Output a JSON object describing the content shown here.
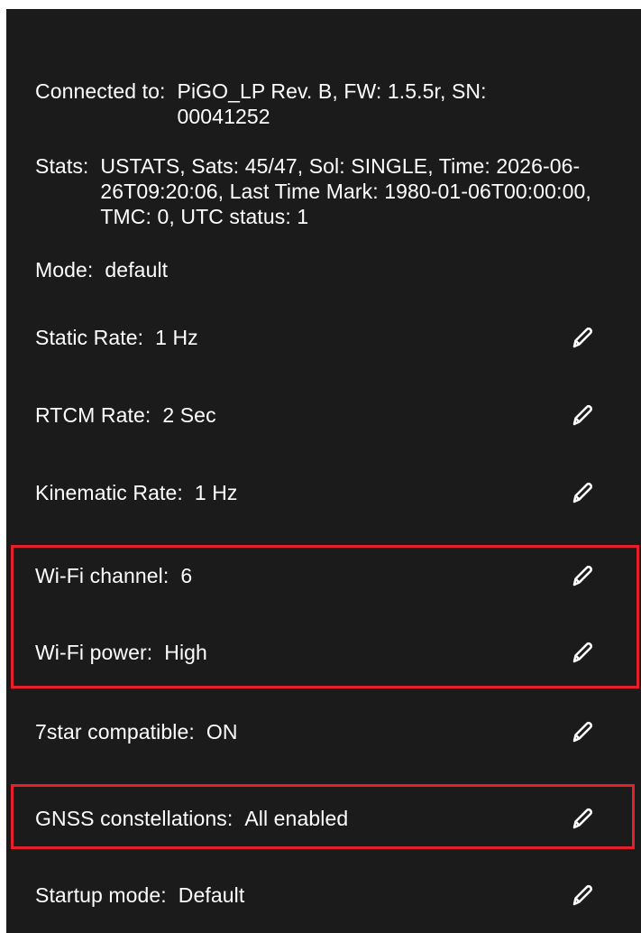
{
  "info": {
    "connected": {
      "label": "Connected to:  ",
      "value": "PiGO_LP Rev. B, FW: 1.5.5r, SN: 00041252"
    },
    "stats": {
      "label": "Stats:  ",
      "value": "USTATS, Sats: 45/47, Sol: SINGLE, Time: 2026-06-26T09:20:06, Last Time Mark: 1980-01-06T00:00:00, TMC: 0, UTC status: 1"
    },
    "mode": {
      "label": "Mode:  ",
      "value": "default"
    }
  },
  "settings": [
    {
      "label": "Static Rate:  ",
      "value": "1 Hz"
    },
    {
      "label": "RTCM Rate:  ",
      "value": "2 Sec"
    },
    {
      "label": "Kinematic Rate:  ",
      "value": "1 Hz"
    },
    {
      "label": "Wi-Fi channel:  ",
      "value": "6"
    },
    {
      "label": "Wi-Fi power:  ",
      "value": "High"
    },
    {
      "label": "7star compatible:  ",
      "value": "ON"
    },
    {
      "label": "GNSS constellations:  ",
      "value": "All enabled"
    },
    {
      "label": "Startup mode:  ",
      "value": "Default"
    }
  ],
  "colors": {
    "background": "#1b1b1b",
    "text": "#ffffff",
    "highlight_border": "#e5202a"
  },
  "icons": {
    "edit": "pencil-icon"
  }
}
